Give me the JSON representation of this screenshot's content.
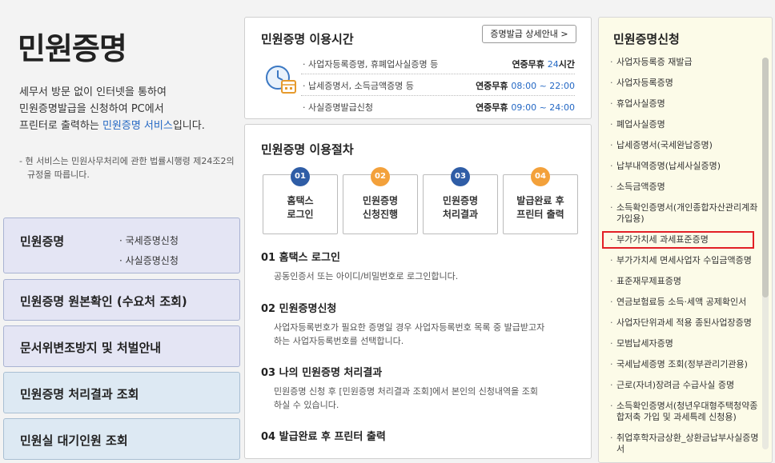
{
  "left": {
    "title": "민원증명",
    "intro_line1": "세무서 방문 없이 인터넷을 통하여",
    "intro_line2": "민원증명발급을 신청하여 PC에서",
    "intro_line3_pre": "프린터로 출력하는 ",
    "intro_line3_hl": "민원증명 서비스",
    "intro_line3_post": "입니다.",
    "note": "- 현 서비스는 민원사무처리에 관한 법률시행령 제24조2의 규정을 따릅니다.",
    "menu": {
      "title": "민원증명",
      "sub1": "· 국세증명신청",
      "sub2": "· 사실증명신청",
      "item2": "민원증명 원본확인 (수요처 조회)",
      "item3": "문서위변조방지 및 처벌안내",
      "item4": "민원증명 처리결과 조회",
      "item5": "민원실 대기인원 조회"
    }
  },
  "hours": {
    "title": "민원증명 이용시간",
    "detail_button": "증명발급 상세안내 >",
    "rows": [
      {
        "label": "· 사업자등록증명, 휴폐업사실증명 등",
        "prefix": "연중무휴 ",
        "time": "24",
        "suffix": "시간"
      },
      {
        "label": "· 납세증명서, 소득금액증명 등",
        "prefix": "연중무휴 ",
        "time": "08:00 ~ 22:00",
        "suffix": ""
      },
      {
        "label": "· 사실증명발급신청",
        "prefix": "연중무휴 ",
        "time": "09:00 ~ 24:00",
        "suffix": ""
      }
    ]
  },
  "procedure": {
    "title": "민원증명 이용절차",
    "steps": [
      {
        "num": "01",
        "line1": "홈택스",
        "line2": "로그인"
      },
      {
        "num": "02",
        "line1": "민원증명",
        "line2": "신청진행"
      },
      {
        "num": "03",
        "line1": "민원증명",
        "line2": "처리결과"
      },
      {
        "num": "04",
        "line1": "발급완료 후",
        "line2": "프린터 출력"
      }
    ],
    "items": [
      {
        "heading": "01 홈택스 로그인",
        "line1": "공동인증서 또는 아이디/비밀번호로 로그인합니다.",
        "line2": ""
      },
      {
        "heading": "02 민원증명신청",
        "line1": "사업자등록번호가 필요한 증명일 경우 사업자등록번호 목록 중 발급받고자",
        "line2": "하는 사업자등록번호를 선택합니다."
      },
      {
        "heading": "03 나의 민원증명 처리결과",
        "line1": "민원증명 신청 후 [민원증명 처리결과 조회]에서 본인의 신청내역을 조회",
        "line2": "하실 수 있습니다."
      },
      {
        "heading": "04 발급완료 후 프린터 출력",
        "line1": "",
        "line2": ""
      }
    ]
  },
  "apply": {
    "title": "민원증명신청",
    "items": [
      "사업자등록증 재발급",
      "사업자등록증명",
      "휴업사실증명",
      "폐업사실증명",
      "납세증명서(국세완납증명)",
      "납부내역증명(납세사실증명)",
      "소득금액증명",
      "소득확인증명서(개인종합자산관리계좌 가입용)",
      "부가가치세 과세표준증명",
      "부가가치세 면세사업자 수입금액증명",
      "표준재무제표증명",
      "연금보험료등 소득·세액 공제확인서",
      "사업자단위과세 적용 종된사업장증명",
      "모범납세자증명",
      "국세납세증명 조회(정부관리기관용)",
      "근로(자녀)장려금 수급사실 증명",
      "소득확인증명서(청년우대형주택청약종합저축 가입 및 과세특례 신청용)",
      "취업후학자금상환_상환금납부사실증명서"
    ],
    "selected_index": 8,
    "bullet": "·"
  },
  "colors": {
    "accent_blue": "#2468c4",
    "step_blue": "#2f5da6",
    "step_orange": "#f3a13b",
    "highlight_red": "#e21f26"
  }
}
